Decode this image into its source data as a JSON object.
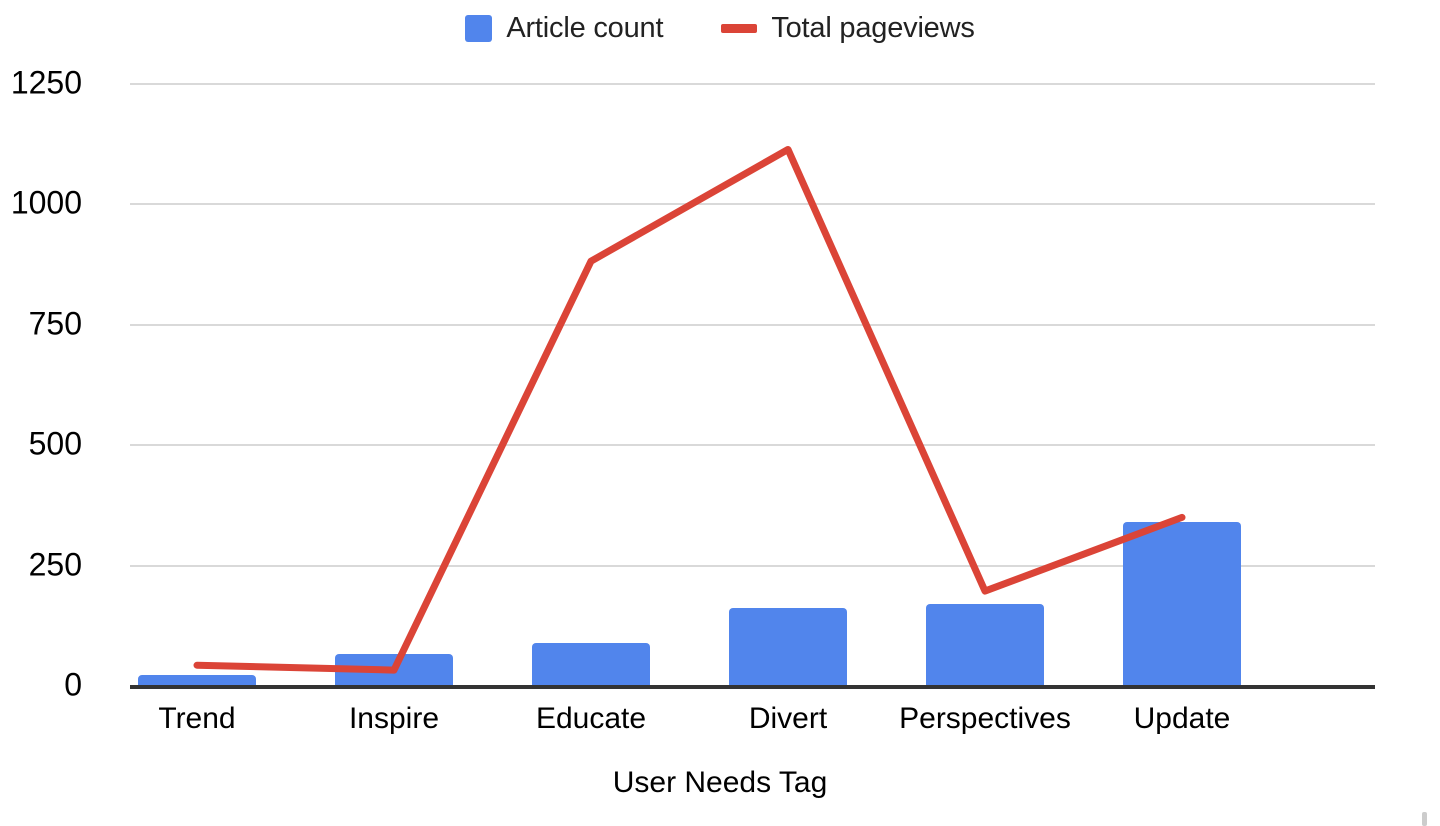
{
  "legend": {
    "position": "top-center",
    "entries": [
      {
        "label": "Article count",
        "color": "#5185ec",
        "marker": "square"
      },
      {
        "label": "Total pageviews",
        "color": "#db4437",
        "marker": "line"
      }
    ]
  },
  "axes": {
    "x_title": "User Needs Tag",
    "y_title": "",
    "y_ticks": [
      "0",
      "250",
      "500",
      "750",
      "1000",
      "1250"
    ],
    "x_ticks": [
      "Trend",
      "Inspire",
      "Educate",
      "Divert",
      "Perspectives",
      "Update"
    ]
  },
  "colors": {
    "bar": "#5185ec",
    "line": "#db4437",
    "gridline": "#d9d9d9",
    "axis": "#333333",
    "text": "#000000",
    "background": "#ffffff"
  },
  "chart_data": {
    "type": "bar",
    "title": "",
    "subtitle": "",
    "xlabel": "User Needs Tag",
    "ylabel": "",
    "categories": [
      "Trend",
      "Inspire",
      "Educate",
      "Divert",
      "Perspectives",
      "Update"
    ],
    "ylim": [
      0,
      1250
    ],
    "ytick_step": 250,
    "grid": true,
    "legend_position": "top-center",
    "series": [
      {
        "name": "Article count",
        "type": "bar",
        "color": "#5185ec",
        "values": [
          20,
          64,
          87,
          160,
          168,
          339
        ]
      },
      {
        "name": "Total pageviews",
        "type": "line",
        "color": "#db4437",
        "values": [
          41,
          31,
          880,
          1112,
          195,
          348
        ]
      }
    ]
  }
}
